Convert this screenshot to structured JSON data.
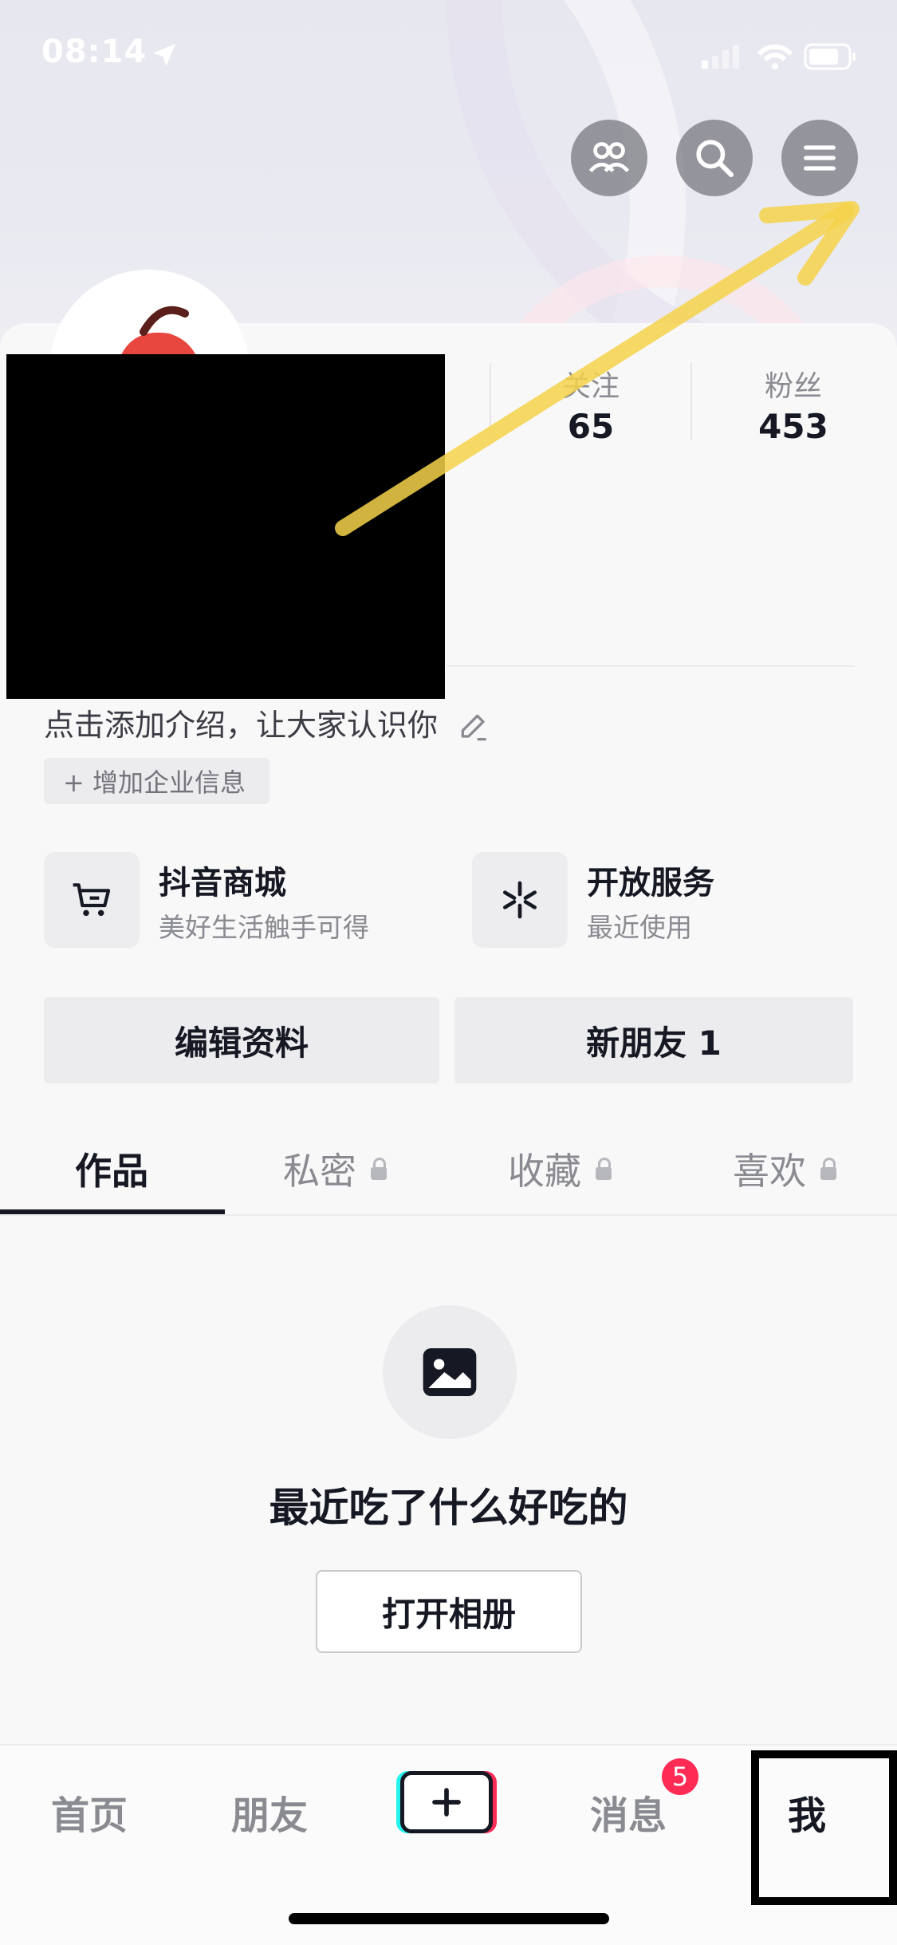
{
  "status_bar": {
    "time": "08:14"
  },
  "stats": [
    {
      "label": "关注",
      "value": "65"
    },
    {
      "label": "粉丝",
      "value": "453"
    }
  ],
  "bio": {
    "text": "点击添加介绍，让大家认识你"
  },
  "corp_tag": {
    "label": "+ 增加企业信息"
  },
  "services": [
    {
      "title": "抖音商城",
      "subtitle": "美好生活触手可得",
      "icon": "cart-icon"
    },
    {
      "title": "开放服务",
      "subtitle": "最近使用",
      "icon": "asterisk-icon"
    }
  ],
  "buttons": {
    "edit_profile": "编辑资料",
    "new_friends": "新朋友 1"
  },
  "tabs": [
    {
      "label": "作品",
      "locked": false,
      "active": true
    },
    {
      "label": "私密",
      "locked": true,
      "active": false
    },
    {
      "label": "收藏",
      "locked": true,
      "active": false
    },
    {
      "label": "喜欢",
      "locked": true,
      "active": false
    }
  ],
  "empty_state": {
    "text": "最近吃了什么好吃的",
    "button": "打开相册"
  },
  "bottom_nav": {
    "items": [
      "首页",
      "朋友",
      "消息",
      "我"
    ],
    "messages_badge": "5"
  },
  "colors": {
    "accent_red": "#fe2c55",
    "accent_cyan": "#25f4ee",
    "annotation_arrow": "#f6d24a"
  }
}
